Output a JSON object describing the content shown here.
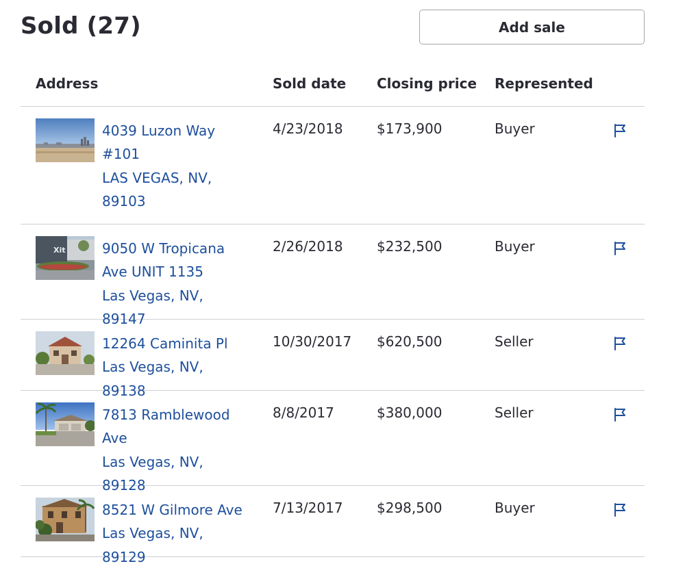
{
  "header": {
    "title": "Sold (27)",
    "add_button_label": "Add sale"
  },
  "table": {
    "columns": {
      "address": "Address",
      "sold_date": "Sold date",
      "closing_price": "Closing price",
      "represented": "Represented"
    },
    "rows": [
      {
        "address_lines": [
          "4039 Luzon Way",
          "#101",
          "LAS VEGAS, NV,",
          "89103"
        ],
        "sold_date": "4/23/2018",
        "closing_price": "$173,900",
        "represented": "Buyer",
        "thumbnail": "city-skyline-photo"
      },
      {
        "address_lines": [
          "9050 W Tropicana",
          "Ave UNIT 1135",
          "Las Vegas, NV, 89147"
        ],
        "sold_date": "2/26/2018",
        "closing_price": "$232,500",
        "represented": "Buyer",
        "thumbnail": "xit-sign-photo"
      },
      {
        "address_lines": [
          "12264 Caminita Pl",
          "Las Vegas, NV, 89138"
        ],
        "sold_date": "10/30/2017",
        "closing_price": "$620,500",
        "represented": "Seller",
        "thumbnail": "house-photo"
      },
      {
        "address_lines": [
          "7813 Ramblewood",
          "Ave",
          "Las Vegas, NV, 89128"
        ],
        "sold_date": "8/8/2017",
        "closing_price": "$380,000",
        "represented": "Seller",
        "thumbnail": "house-palm-photo"
      },
      {
        "address_lines": [
          "8521 W Gilmore Ave",
          "Las Vegas, NV, 89129"
        ],
        "sold_date": "7/13/2017",
        "closing_price": "$298,500",
        "represented": "Buyer",
        "thumbnail": "villa-photo"
      }
    ]
  },
  "colors": {
    "link": "#1d4f9c",
    "text": "#2a2a33",
    "divider": "#cfcfd4",
    "button_border": "#a7a6ab"
  },
  "icons": {
    "row_action": "flag-icon"
  }
}
